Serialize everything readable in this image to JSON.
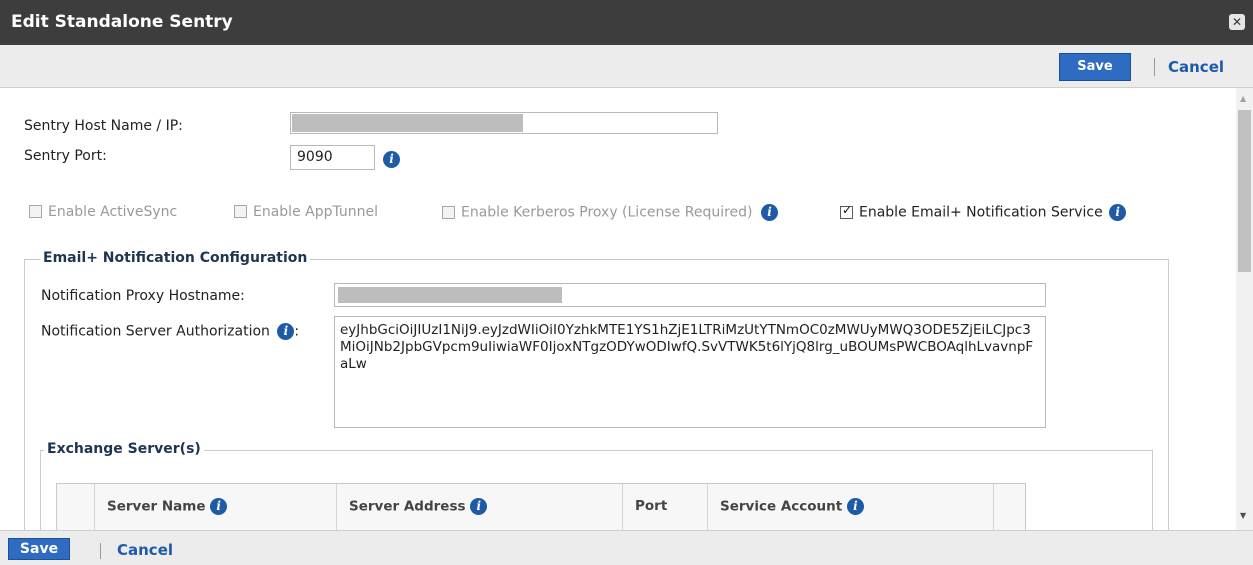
{
  "dialog": {
    "title": "Edit Standalone Sentry"
  },
  "toolbar": {
    "save_label": "Save",
    "cancel_label": "Cancel"
  },
  "form": {
    "host_label": "Sentry Host Name / IP:",
    "host_value": "",
    "port_label": "Sentry Port:",
    "port_value": "9090"
  },
  "checkboxes": [
    {
      "label": "Enable ActiveSync",
      "checked": false,
      "enabled": false
    },
    {
      "label": "Enable AppTunnel",
      "checked": false,
      "enabled": false
    },
    {
      "label": "Enable Kerberos Proxy (License Required)",
      "checked": false,
      "enabled": false
    },
    {
      "label": "Enable Email+ Notification Service",
      "checked": true,
      "enabled": true
    }
  ],
  "notification": {
    "legend": "Email+ Notification Configuration",
    "proxy_label": "Notification Proxy Hostname:",
    "proxy_value": "",
    "auth_label": "Notification Server Authorization",
    "auth_suffix": ":",
    "auth_value": "eyJhbGciOiJIUzI1NiJ9.eyJzdWIiOiI0YzhkMTE1YS1hZjE1LTRiMzUtYTNmOC0zMWUyMWQ3ODE5ZjEiLCJpc3MiOiJNb2JpbGVpcm9uIiwiaWF0IjoxNTgzODYwODIwfQ.SvVTWK5t6lYjQ8lrg_uBOUMsPWCBOAqlhLvavnpFaLw"
  },
  "exchange": {
    "legend": "Exchange Server(s)",
    "columns": [
      "Server Name",
      "Server Address",
      "Port",
      "Service Account"
    ]
  },
  "footer": {
    "save_label": "Save",
    "cancel_label": "Cancel"
  },
  "colors": {
    "titlebar": "#3d3d3d",
    "primary_button": "#2e6cc1",
    "link": "#1d5aa8",
    "info_icon": "#1f5aa6"
  }
}
